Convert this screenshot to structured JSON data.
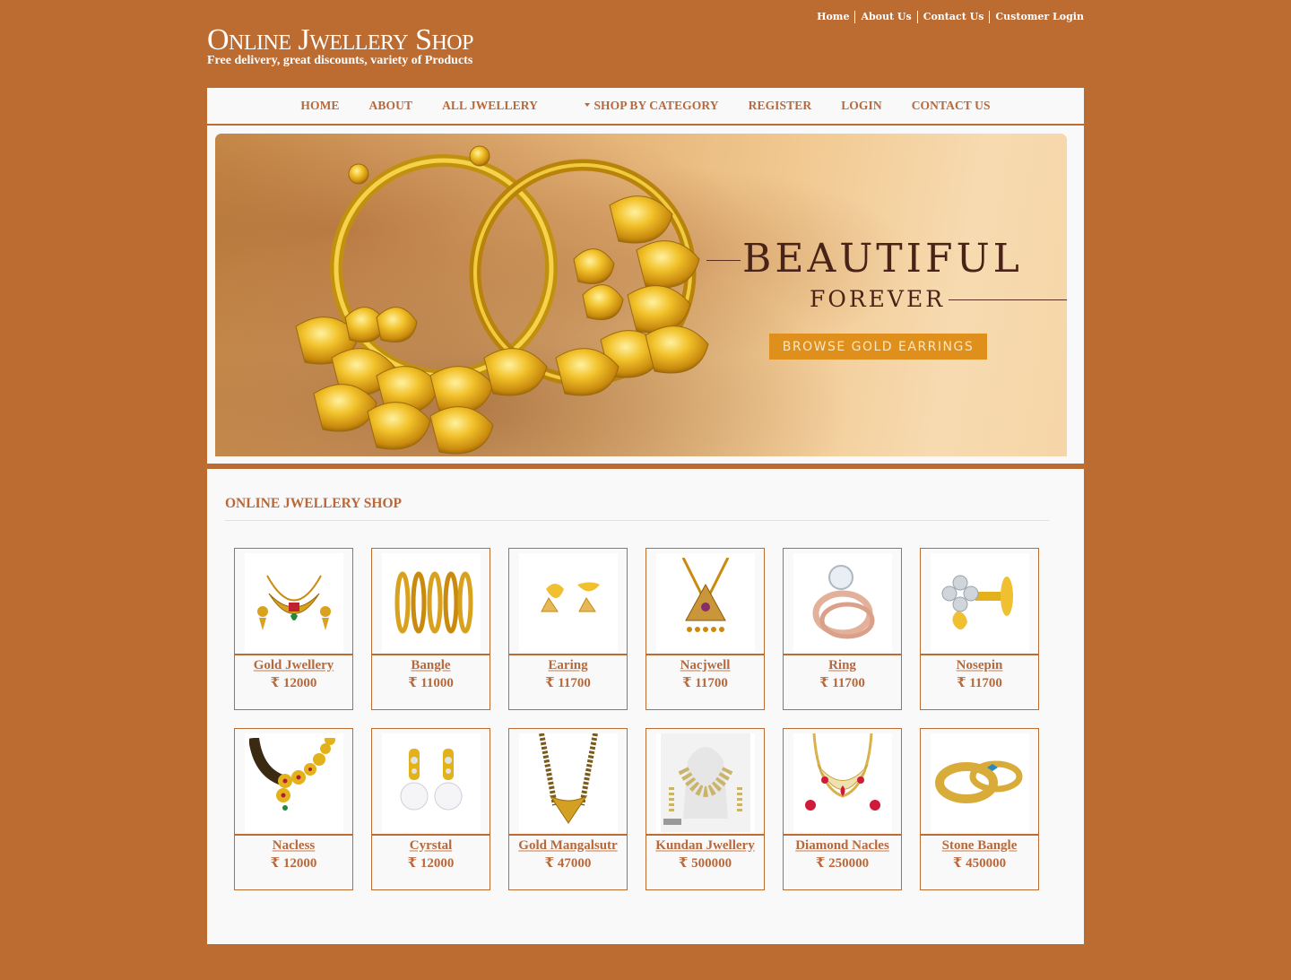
{
  "top_links": [
    "Home",
    "About Us",
    "Contact Us",
    "Customer Login"
  ],
  "logo": {
    "title": "Online Jwellery Shop",
    "tagline": "Free delivery, great discounts, variety of Products"
  },
  "nav": {
    "items": [
      "HOME",
      "ABOUT",
      "ALL JWELLERY",
      "SHOP BY CATEGORY",
      "REGISTER",
      "LOGIN",
      "CONTACT US"
    ]
  },
  "banner": {
    "headline": "BEAUTIFUL",
    "subheadline": "FOREVER",
    "cta": "BROWSE GOLD EARRINGS"
  },
  "section": {
    "title": "ONLINE JWELLERY SHOP"
  },
  "currency": "₹",
  "products": [
    {
      "name": "Gold Jwellery",
      "price": "₹ 12000",
      "icon": "necklace-set"
    },
    {
      "name": "Bangle",
      "price": "₹ 11000",
      "icon": "bangles"
    },
    {
      "name": "Earing",
      "price": "₹ 11700",
      "icon": "earrings"
    },
    {
      "name": "Nacjwell",
      "price": "₹ 11700",
      "icon": "pendant-necklace"
    },
    {
      "name": "Ring",
      "price": "₹ 11700",
      "icon": "diamond-ring"
    },
    {
      "name": "Nosepin",
      "price": "₹ 11700",
      "icon": "nosepin"
    },
    {
      "name": "Nacless",
      "price": "₹ 12000",
      "icon": "flower-necklace"
    },
    {
      "name": "Cyrstal",
      "price": "₹ 12000",
      "icon": "pearl-earrings"
    },
    {
      "name": "Gold Mangalsutr",
      "price": "₹ 47000",
      "icon": "mangalsutra"
    },
    {
      "name": "Kundan Jwellery",
      "price": "₹ 500000",
      "icon": "kundan-set"
    },
    {
      "name": "Diamond Nacles",
      "price": "₹ 250000",
      "icon": "diamond-necklace"
    },
    {
      "name": "Stone Bangle",
      "price": "₹ 450000",
      "icon": "stone-bangle"
    }
  ],
  "colors": {
    "brand": "#bc6c31",
    "link": "#b8683a",
    "panel": "#f9f9f9",
    "cta": "#df8f1c"
  }
}
